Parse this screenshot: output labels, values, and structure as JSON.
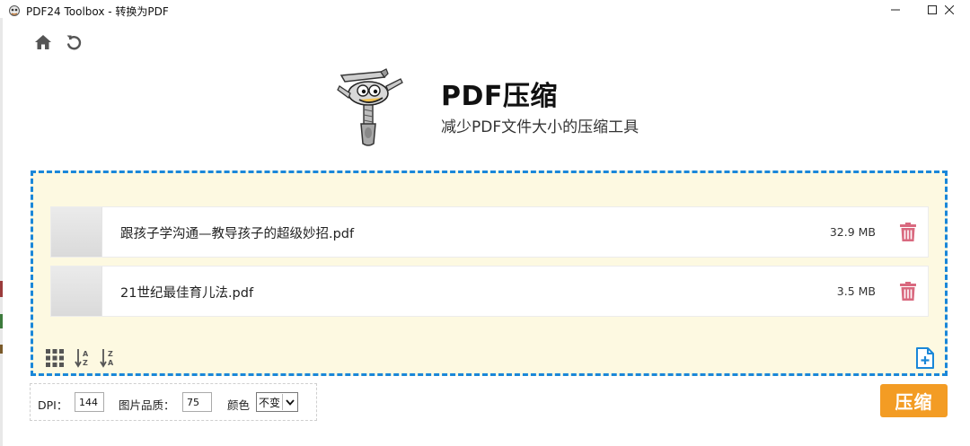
{
  "window": {
    "title": "PDF24 Toolbox - 转换为PDF",
    "minimize_icon": "minimize-icon",
    "maximize_icon": "maximize-icon",
    "close_icon": "close-icon"
  },
  "toolbar": {
    "home_icon": "home-icon",
    "back_icon": "undo-icon"
  },
  "header": {
    "title": "PDF压缩",
    "subtitle": "减少PDF文件大小的压缩工具",
    "logo": "pdf24-mascot-compressor"
  },
  "files": [
    {
      "name": "跟孩子学沟通—教导孩子的超级妙招.pdf",
      "size": "32.9 MB",
      "delete_icon": "trash-icon"
    },
    {
      "name": "21世纪最佳育儿法.pdf",
      "size": "3.5 MB",
      "delete_icon": "trash-icon"
    }
  ],
  "dropzone_tools": {
    "grid_icon": "grid-view-icon",
    "sort_az_icon": "sort-az-icon",
    "sort_za_icon": "sort-za-icon",
    "add_file_icon": "add-file-icon"
  },
  "options": {
    "dpi_label": "DPI：",
    "dpi_value": "144",
    "quality_label": "图片品质：",
    "quality_value": "75",
    "color_label": "颜色",
    "color_value": "不变"
  },
  "actions": {
    "compress_label": "压缩"
  },
  "colors": {
    "accent_blue": "#1a87d8",
    "dropzone_bg": "#fdf9e1",
    "compress_orange": "#f39c24",
    "trash_pink": "#d9697f"
  }
}
